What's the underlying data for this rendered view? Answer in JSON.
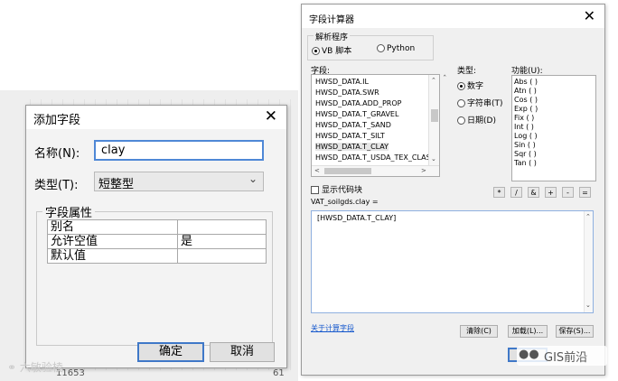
{
  "add_field_dialog": {
    "title": "添加字段",
    "close_glyph": "✕",
    "name_label": "名称(N):",
    "name_value": "clay",
    "type_label": "类型(T):",
    "type_value": "短整型",
    "field_properties_title": "字段属性",
    "properties": [
      {
        "name": "别名",
        "value": ""
      },
      {
        "name": "允许空值",
        "value": "是"
      },
      {
        "name": "默认值",
        "value": ""
      }
    ],
    "ok_label": "确定",
    "cancel_label": "取消"
  },
  "field_calculator": {
    "title": "字段计算器",
    "close_glyph": "✕",
    "parser_title": "解析程序",
    "parser_options": [
      {
        "label": "VB 脚本",
        "selected": true
      },
      {
        "label": "Python",
        "selected": false
      }
    ],
    "fields_label": "字段:",
    "fields": [
      "HWSD_DATA.IL",
      "HWSD_DATA.SWR",
      "HWSD_DATA.ADD_PROP",
      "HWSD_DATA.T_GRAVEL",
      "HWSD_DATA.T_SAND",
      "HWSD_DATA.T_SILT",
      "HWSD_DATA.T_CLAY",
      "HWSD_DATA.T_USDA_TEX_CLASS"
    ],
    "selected_field": "HWSD_DATA.T_CLAY",
    "type_label": "类型:",
    "type_options": [
      {
        "label": "数字",
        "selected": true
      },
      {
        "label": "字符串(T)",
        "selected": false
      },
      {
        "label": "日期(D)",
        "selected": false
      }
    ],
    "functions_label": "功能(U):",
    "functions": [
      "Abs ( )",
      "Atn ( )",
      "Cos ( )",
      "Exp ( )",
      "Fix ( )",
      "Int ( )",
      "Log ( )",
      "Sin ( )",
      "Sqr ( )",
      "Tan ( )"
    ],
    "show_codeblock_label": "显示代码块",
    "expression_label": "VAT_soilgds.clay =",
    "expression": "[HWSD_DATA.T_CLAY]",
    "operators": [
      "*",
      "/",
      "&",
      "+",
      "-",
      "="
    ],
    "about_link": "关于计算字段",
    "clear_label": "清除(C)",
    "load_label": "加载(L)...",
    "save_label": "保存(S)..."
  },
  "background": {
    "bottom_number_left": "11653",
    "bottom_number_right": "61"
  },
  "watermarks": {
    "left": "六敏验棱",
    "right": "GIS前沿"
  }
}
